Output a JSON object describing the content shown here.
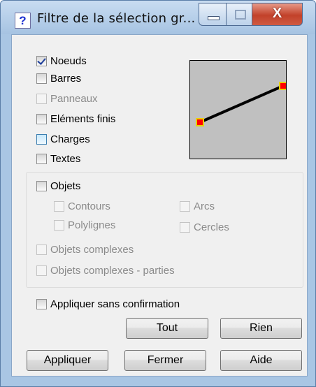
{
  "window": {
    "title": "Filtre de la sélection gr...",
    "title_icon": "?",
    "close_glyph": "X"
  },
  "filters": [
    {
      "label": "Noeuds",
      "checked": true,
      "enabled": true
    },
    {
      "label": "Barres",
      "checked": false,
      "enabled": true
    },
    {
      "label": "Panneaux",
      "checked": false,
      "enabled": false
    },
    {
      "label": "Eléments finis",
      "checked": false,
      "enabled": true
    },
    {
      "label": "Charges",
      "checked": false,
      "enabled": true,
      "hover": true
    },
    {
      "label": "Textes",
      "checked": false,
      "enabled": true
    }
  ],
  "objects_group": {
    "objets": {
      "label": "Objets",
      "checked": false,
      "enabled": true
    },
    "contours": {
      "label": "Contours",
      "checked": false,
      "enabled": false
    },
    "arcs": {
      "label": "Arcs",
      "checked": false,
      "enabled": false
    },
    "polylignes": {
      "label": "Polylignes",
      "checked": false,
      "enabled": false
    },
    "cercles": {
      "label": "Cercles",
      "checked": false,
      "enabled": false
    },
    "objets_complexes": {
      "label": "Objets complexes",
      "checked": false,
      "enabled": false
    },
    "objets_complexes_parties": {
      "label": "Objets complexes - parties",
      "checked": false,
      "enabled": false
    }
  },
  "apply_without_confirm": {
    "label": "Appliquer sans confirmation",
    "checked": false
  },
  "buttons": {
    "tout": "Tout",
    "rien": "Rien",
    "appliquer": "Appliquer",
    "fermer": "Fermer",
    "aide": "Aide"
  },
  "preview": {
    "background": "#c0c0c0",
    "line_color": "#000000",
    "node_fill": "#ff0000",
    "node_border": "#e8d000"
  }
}
